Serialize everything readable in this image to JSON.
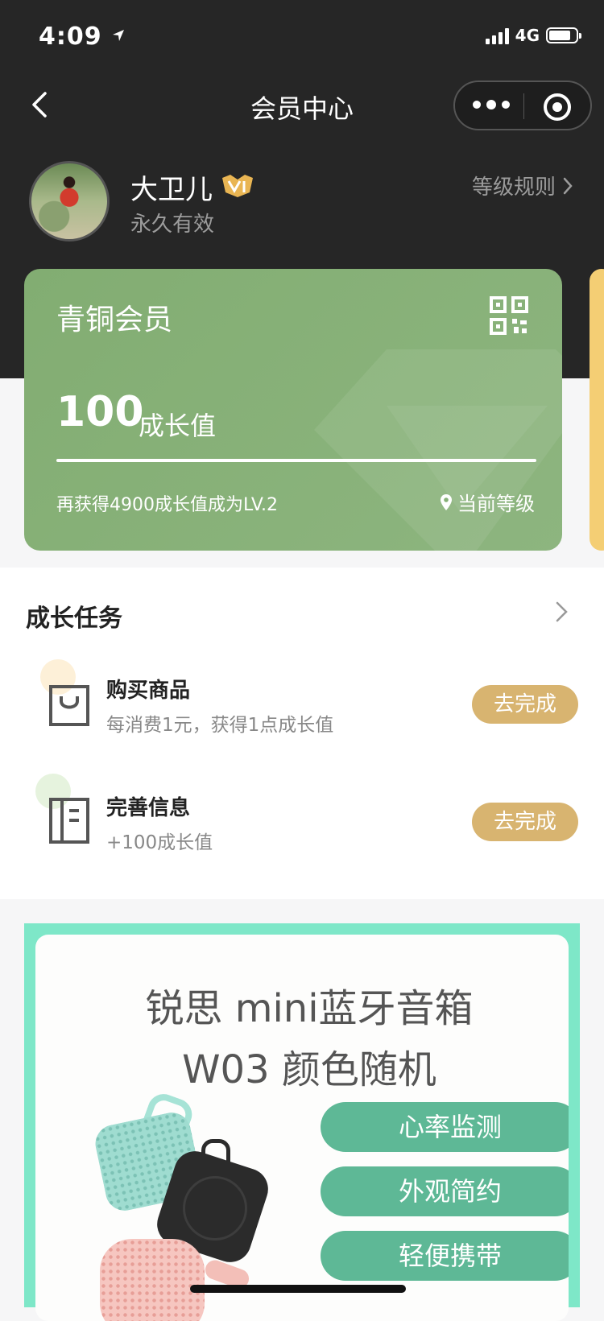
{
  "status_bar": {
    "time": "4:09",
    "network": "4G"
  },
  "nav": {
    "title": "会员中心"
  },
  "profile": {
    "name": "大卫儿",
    "validity": "永久有效",
    "level_rules_link": "等级规则"
  },
  "member_card": {
    "level_name": "青铜会员",
    "growth_value": "100",
    "growth_unit": "成长值",
    "progress": 0.02,
    "next_level_hint": "再获得4900成长值成为LV.2",
    "current_level_label": "当前等级",
    "card_color": "#86b077"
  },
  "growth_tasks": {
    "title": "成长任务",
    "items": [
      {
        "title": "购买商品",
        "desc": "每消费1元，获得1点成长值",
        "action": "去完成",
        "icon": "shopping-bag-icon"
      },
      {
        "title": "完善信息",
        "desc": "+100成长值",
        "action": "去完成",
        "icon": "profile-doc-icon"
      }
    ],
    "action_color": "#d8b470"
  },
  "banner": {
    "line1": "锐思 mini蓝牙音箱",
    "line2": "W03 颜色随机",
    "features": [
      "心率监测",
      "外观简约",
      "轻便携带"
    ],
    "accent": "#5eb896"
  }
}
